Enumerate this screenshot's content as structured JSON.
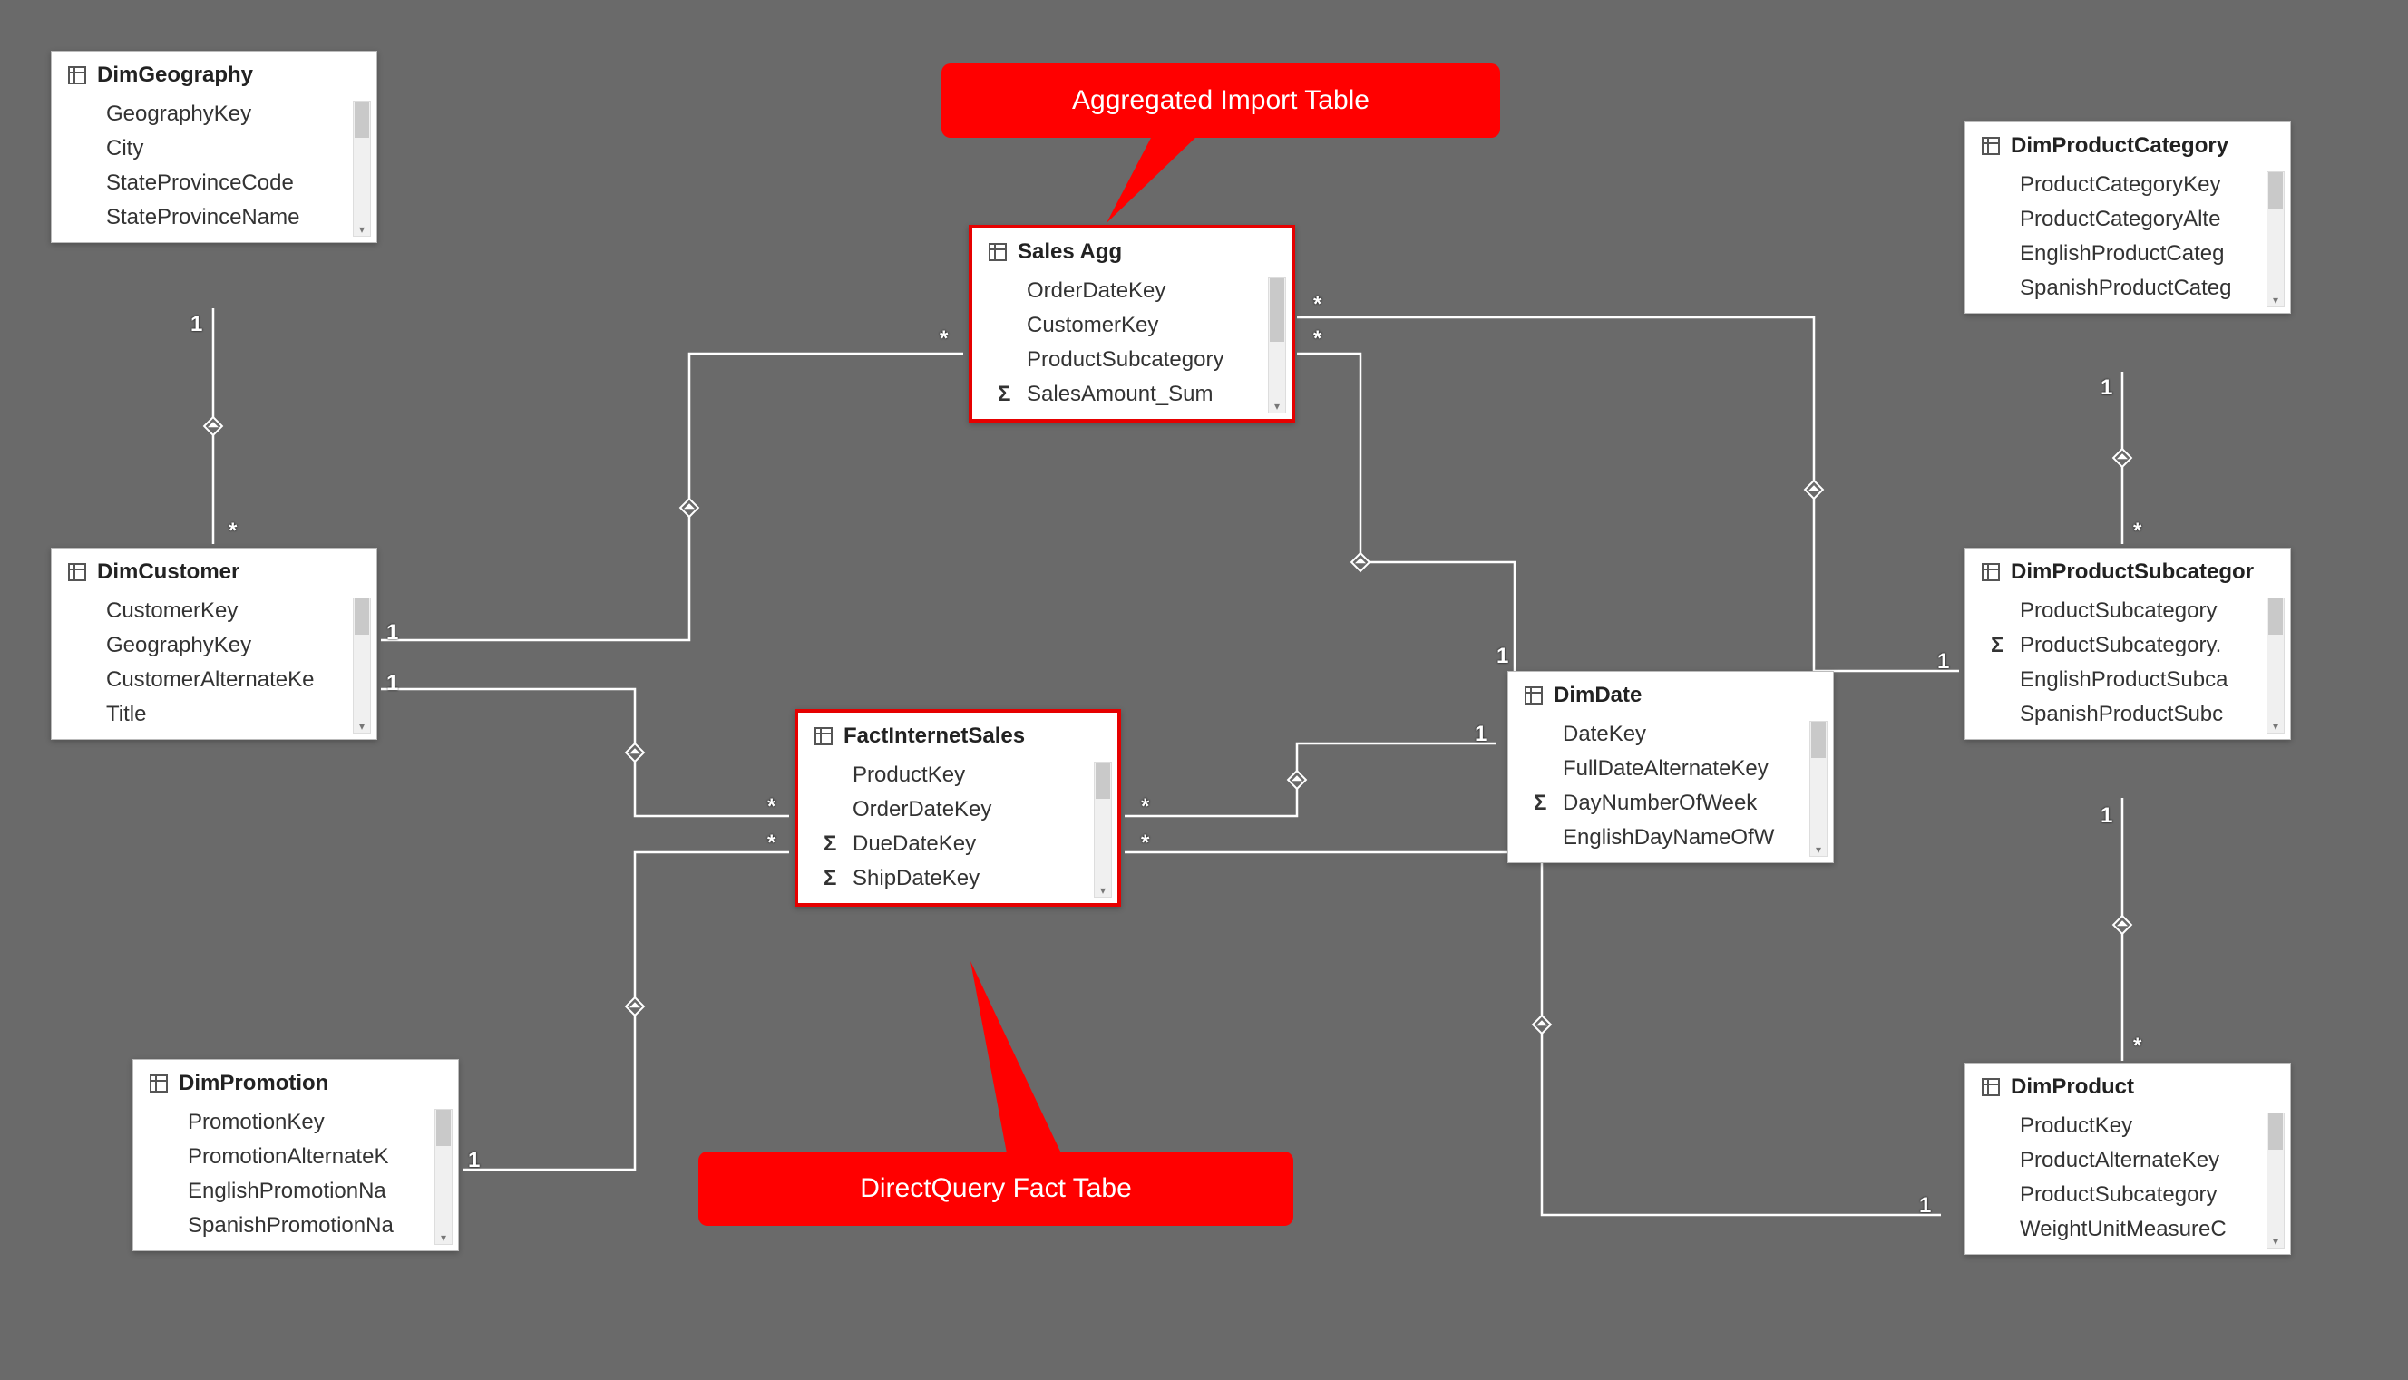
{
  "callouts": {
    "top": "Aggregated Import Table",
    "bottom": "DirectQuery Fact Tabe"
  },
  "tables": {
    "dimGeography": {
      "title": "DimGeography",
      "fields": [
        "GeographyKey",
        "City",
        "StateProvinceCode",
        "StateProvinceName"
      ]
    },
    "dimCustomer": {
      "title": "DimCustomer",
      "fields": [
        "CustomerKey",
        "GeographyKey",
        "CustomerAlternateKe",
        "Title"
      ]
    },
    "dimPromotion": {
      "title": "DimPromotion",
      "fields": [
        "PromotionKey",
        "PromotionAlternateK",
        "EnglishPromotionNa",
        "SpanishPromotionNa"
      ]
    },
    "salesAgg": {
      "title": "Sales Agg",
      "fields": [
        {
          "name": "OrderDateKey"
        },
        {
          "name": "CustomerKey"
        },
        {
          "name": "ProductSubcategory"
        },
        {
          "name": "SalesAmount_Sum",
          "measure": true
        }
      ]
    },
    "factInternetSales": {
      "title": "FactInternetSales",
      "fields": [
        {
          "name": "ProductKey"
        },
        {
          "name": "OrderDateKey"
        },
        {
          "name": "DueDateKey",
          "measure": true
        },
        {
          "name": "ShipDateKey",
          "measure": true
        }
      ]
    },
    "dimDate": {
      "title": "DimDate",
      "fields": [
        {
          "name": "DateKey"
        },
        {
          "name": "FullDateAlternateKey"
        },
        {
          "name": "DayNumberOfWeek",
          "measure": true
        },
        {
          "name": "EnglishDayNameOfW"
        }
      ]
    },
    "dimProductCategory": {
      "title": "DimProductCategory",
      "fields": [
        "ProductCategoryKey",
        "ProductCategoryAlte",
        "EnglishProductCateg",
        "SpanishProductCateg"
      ]
    },
    "dimProductSubcategory": {
      "title": "DimProductSubcategor",
      "fields": [
        {
          "name": "ProductSubcategory"
        },
        {
          "name": "ProductSubcategory.",
          "measure": true
        },
        {
          "name": "EnglishProductSubca"
        },
        {
          "name": "SpanishProductSubc"
        }
      ]
    },
    "dimProduct": {
      "title": "DimProduct",
      "fields": [
        "ProductKey",
        "ProductAlternateKey",
        "ProductSubcategory",
        "WeightUnitMeasureC"
      ]
    }
  },
  "cardinality": {
    "one": "1",
    "many": "*"
  }
}
